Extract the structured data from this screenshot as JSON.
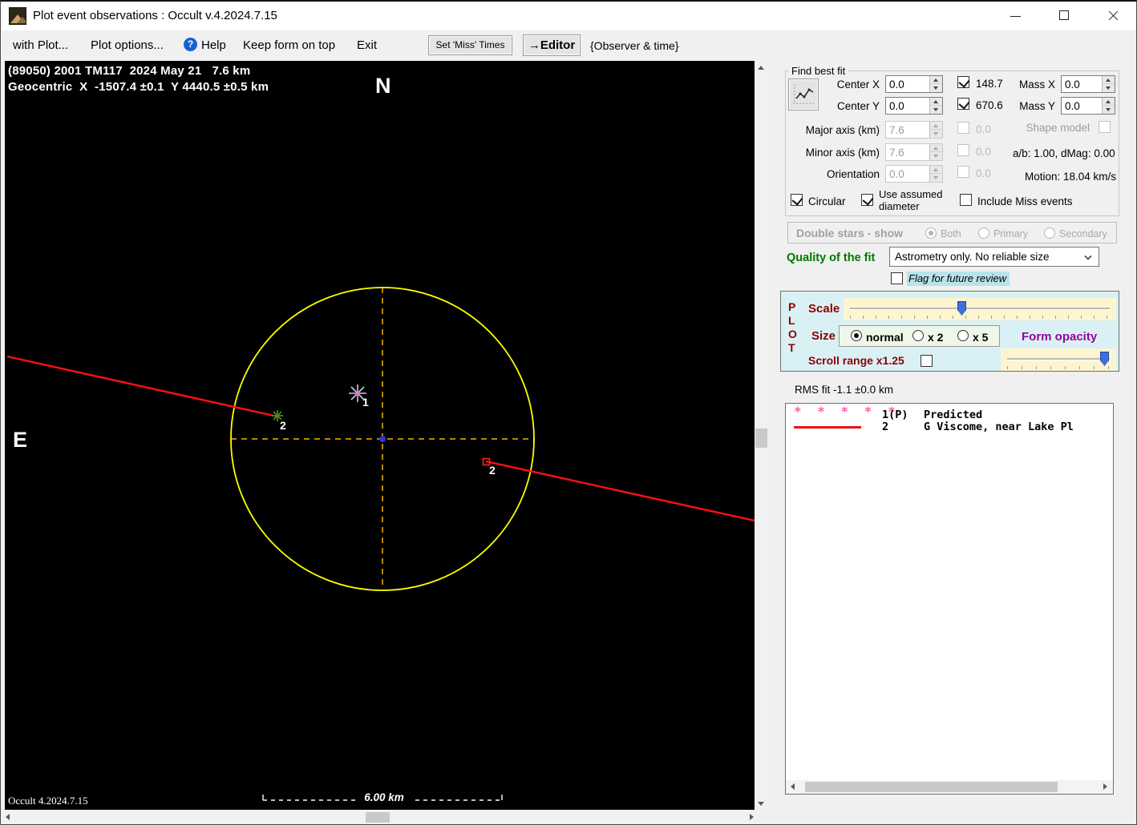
{
  "window": {
    "title": "Plot event observations : Occult v.4.2024.7.15"
  },
  "menubar": {
    "with_plot": "with Plot...",
    "plot_options": "Plot options...",
    "help_glyph": "?",
    "help": "Help",
    "keep_on_top": "Keep form on top",
    "exit": "Exit",
    "set_miss_times": "Set 'Miss' Times",
    "editor": "→Editor",
    "observer_time": "{Observer & time}"
  },
  "plot": {
    "header_line1": "(89050) 2001 TM117  2024 May 21   7.6 km",
    "header_line2": "Geocentric  X  -1507.4 ±0.1  Y 4440.5 ±0.5 km",
    "north_label": "N",
    "east_label": "E",
    "marker1_label": "1",
    "marker2_left_label": "2",
    "marker2_right_label": "2",
    "scale_bar_label": "6.00 km",
    "version_label": "Occult 4.2024.7.15",
    "colors": {
      "circle": "#ffff00",
      "chord": "#ff1010",
      "crosshair": "#bb8500",
      "center_dot": "#2b35e0"
    }
  },
  "find_best_fit": {
    "legend": "Find best fit",
    "center_x_label": "Center X",
    "center_x_value": "0.0",
    "center_y_label": "Center Y",
    "center_y_value": "0.0",
    "fit_x_check_label": "148.7",
    "fit_y_check_label": "670.6",
    "mass_x_label": "Mass X",
    "mass_x_value": "0.0",
    "mass_y_label": "Mass Y",
    "mass_y_value": "0.0",
    "major_axis_label": "Major axis (km)",
    "major_axis_value": "7.6",
    "major_axis_check_label": "0.0",
    "minor_axis_label": "Minor axis (km)",
    "minor_axis_value": "7.6",
    "minor_axis_check_label": "0.0",
    "orientation_label": "Orientation",
    "orientation_value": "0.0",
    "orientation_check_label": "0.0",
    "shape_model_label": "Shape model",
    "ab_dmag_label": "a/b: 1.00, dMag: 0.00",
    "motion_label": "Motion: 18.04 km/s",
    "circular_label": "Circular",
    "use_assumed_line1": "Use assumed",
    "use_assumed_line2": "diameter",
    "include_miss_label": "Include Miss events"
  },
  "double_stars": {
    "label": "Double stars - show",
    "options": [
      "Both",
      "Primary",
      "Secondary"
    ],
    "selected": "Both"
  },
  "quality": {
    "label": "Quality of the fit",
    "value": "Astrometry only. No reliable size",
    "flag_label": "Flag for future review"
  },
  "plot_panel": {
    "letters": [
      "P",
      "L",
      "O",
      "T"
    ],
    "scale_label": "Scale",
    "size_label": "Size",
    "size_options": [
      "normal",
      "x 2",
      "x 5"
    ],
    "size_selected": "normal",
    "form_opacity_label": "Form opacity",
    "scroll_range_label": "Scroll range x1.25"
  },
  "rms": {
    "label": "RMS fit -1.1 ±0.0 km"
  },
  "legend": {
    "entries": [
      {
        "id": "1(P)",
        "name": "Predicted",
        "line_style": "dotted",
        "color": "#ff5fae",
        "sample_glyphs": "* * * * *"
      },
      {
        "id": "2",
        "name": "G Viscome, near Lake Pl",
        "line_style": "solid",
        "color": "#ee1111"
      }
    ]
  }
}
